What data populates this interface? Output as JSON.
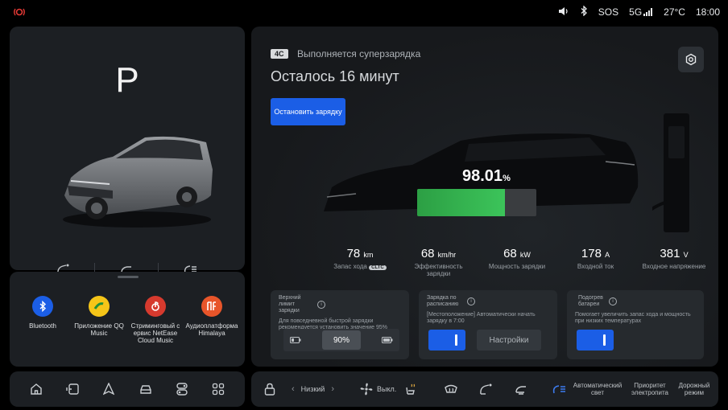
{
  "status": {
    "sos": "SOS",
    "network": "5G",
    "temperature": "27°C",
    "time": "18:00",
    "icons": [
      "alert-icon",
      "volume-icon",
      "bluetooth-icon",
      "signal-icon"
    ]
  },
  "vehicle": {
    "gear": "P"
  },
  "apps": [
    {
      "label": "Bluetooth",
      "icon": "bluetooth-icon",
      "color": "#1b5ee6"
    },
    {
      "label": "Приложение QQ Music",
      "icon": "qq-music-icon",
      "color": "#f5c518"
    },
    {
      "label": "Стриминговый с ервис NetEase Cloud Music",
      "icon": "netease-icon",
      "color": "#d63a2e"
    },
    {
      "label": "Аудиоплатформа Himalaya",
      "icon": "himalaya-icon",
      "color": "#e8552a"
    }
  ],
  "charging": {
    "badge": "4C",
    "title": "Выполняется суперзарядка",
    "remaining": "Осталось 16 минут",
    "stop_label": "Остановить зарядку",
    "percent": "98.01",
    "percent_unit": "%",
    "percent_value": 0.9801,
    "accent": "#1b5ee6",
    "battery_color": "#3cc45a"
  },
  "stats": [
    {
      "value": "78",
      "unit": "km",
      "label": "Запас хода",
      "badge": "CLTC"
    },
    {
      "value": "68",
      "unit": "km/hr",
      "label": "Эффективность зарядки"
    },
    {
      "value": "68",
      "unit": "kW",
      "label": "Мощность зарядки"
    },
    {
      "value": "178",
      "unit": "A",
      "label": "Входной ток"
    },
    {
      "value": "381",
      "unit": "V",
      "label": "Входное напряжение"
    }
  ],
  "cards": {
    "limit": {
      "title": "Верхний лимит зарядки",
      "desc": "Для повседневной быстрой зарядки рекомендуется установить значение 95%",
      "value": "90%"
    },
    "schedule": {
      "title": "Зарядка по расписанию",
      "desc": "[Местоположение] Автоматически начать зарядку в 7:00",
      "settings_label": "Настройки"
    },
    "heating": {
      "title": "Подогрев батареи",
      "desc": "Помогает увеличить запас хода и мощность при низких температурах"
    }
  },
  "dock": {
    "left_icons": [
      "home-icon",
      "phone-icon",
      "navigation-icon",
      "car-icon",
      "settings-icon",
      "apps-icon"
    ],
    "fan_mode": "Низкий",
    "fan_status": "Выкл.",
    "auto_light": "Автоматический свет",
    "ev_priority": "Приоритет электропита",
    "drive_mode": "Дорожный режим"
  }
}
